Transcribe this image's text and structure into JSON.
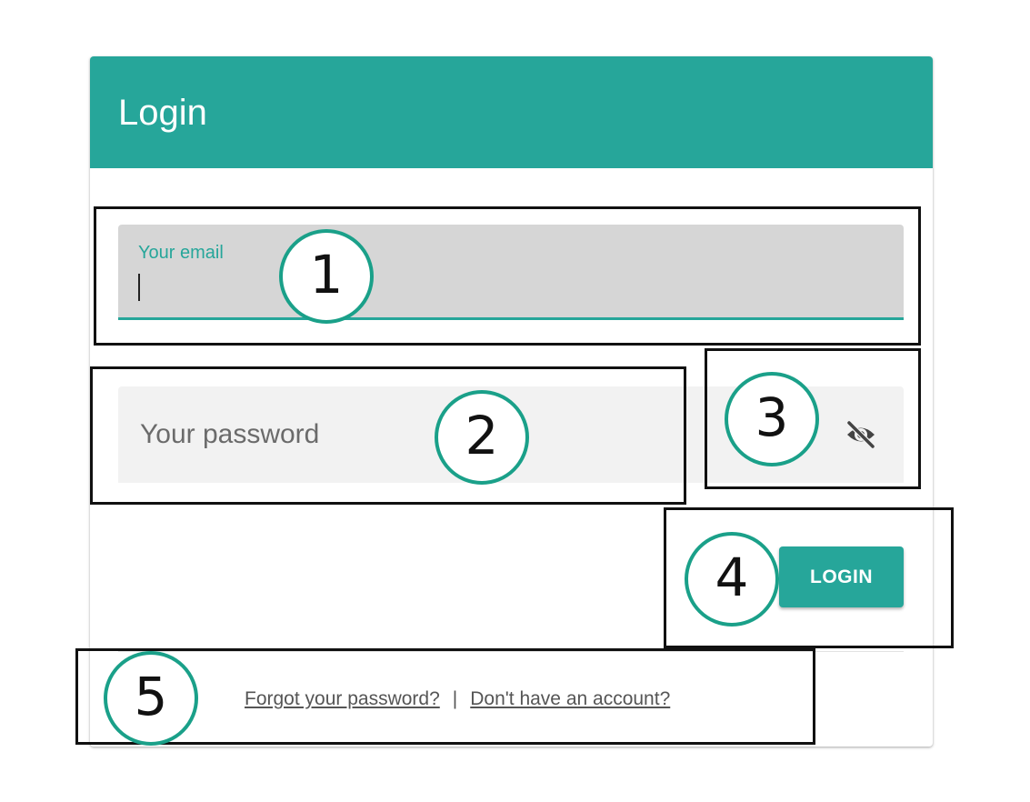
{
  "login_card": {
    "title": "Login",
    "email_field": {
      "label": "Your email",
      "value": ""
    },
    "password_field": {
      "placeholder": "Your password",
      "value": ""
    },
    "visibility_toggle_icon": "eye-off-icon",
    "login_button_label": "LOGIN",
    "forgot_password_link": "Forgot your password?",
    "separator": "|",
    "signup_link": "Don't have an account?"
  },
  "callouts": [
    "1",
    "2",
    "3",
    "4",
    "5"
  ],
  "colors": {
    "header": "#26a69a",
    "accent": "#26a69a",
    "email_field_bg": "#d6d6d6",
    "password_field_bg": "#f2f2f2",
    "callout_circle": "#1aa089"
  }
}
